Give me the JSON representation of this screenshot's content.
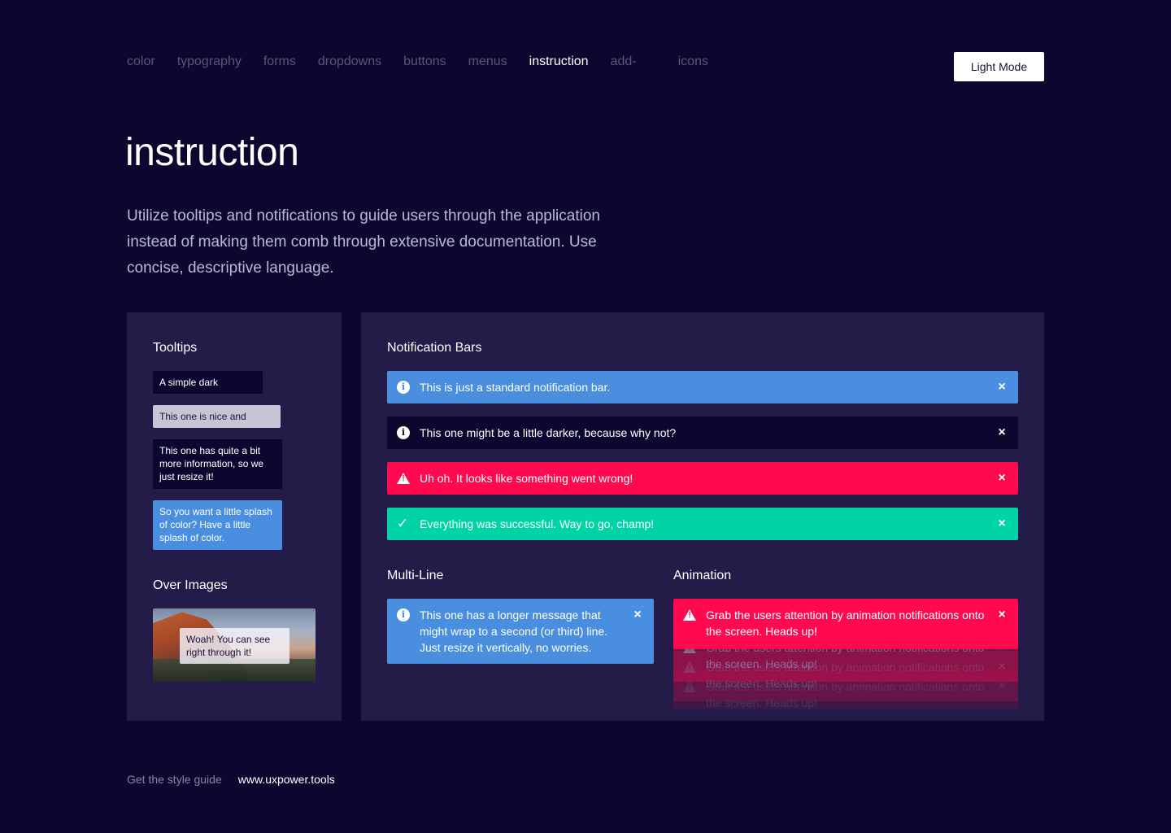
{
  "nav": {
    "items": [
      {
        "label": "color",
        "active": false
      },
      {
        "label": "typography",
        "active": false
      },
      {
        "label": "forms",
        "active": false
      },
      {
        "label": "dropdowns",
        "active": false
      },
      {
        "label": "buttons",
        "active": false
      },
      {
        "label": "menus",
        "active": false
      },
      {
        "label": "instruction",
        "active": true
      },
      {
        "label": "add-",
        "active": false
      },
      {
        "label": "icons",
        "active": false
      }
    ],
    "mode_button": "Light Mode"
  },
  "page": {
    "title": "instruction",
    "intro": "Utilize tooltips and notifications to guide users through the application instead of making them comb through extensive documentation. Use concise, descriptive language."
  },
  "tooltips": {
    "heading": "Tooltips",
    "items": [
      {
        "text": "A simple dark",
        "style": "dark"
      },
      {
        "text": "This one is nice and",
        "style": "light"
      },
      {
        "text": "This one has quite a bit more information, so we just resize it!",
        "style": "dark"
      },
      {
        "text": "So you want a little splash of color? Have a little splash of color.",
        "style": "blue"
      }
    ],
    "over_images_heading": "Over Images",
    "over_image_text": "Woah! You can see right through it!"
  },
  "notifications": {
    "heading": "Notification Bars",
    "bars": [
      {
        "text": "This is just a standard notification bar.",
        "type": "info",
        "color": "#4a8ee0"
      },
      {
        "text": "This one might be a little darker, because why not?",
        "type": "info",
        "color": "#0f0630"
      },
      {
        "text": "Uh oh. It looks like something went wrong!",
        "type": "warning",
        "color": "#ff0a4e"
      },
      {
        "text": "Everything was successful. Way to go, champ!",
        "type": "success",
        "color": "#00d4a6"
      }
    ],
    "multiline_heading": "Multi-Line",
    "multiline_text": "This one has a longer message that might wrap to a second (or third) line. Just resize it vertically, no worries.",
    "animation_heading": "Animation",
    "animation_text": "Grab the users attention by animation notifications onto the screen. Heads up!"
  },
  "icons": {
    "info": "i",
    "warning": "!",
    "success": "✓",
    "close": "×"
  },
  "footer": {
    "label": "Get the style guide",
    "link": "www.uxpower.tools"
  },
  "colors": {
    "background": "#0f0630",
    "panel": "#231b48",
    "blue": "#4a8ee0",
    "red": "#ff0a4e",
    "green": "#00d4a6"
  }
}
